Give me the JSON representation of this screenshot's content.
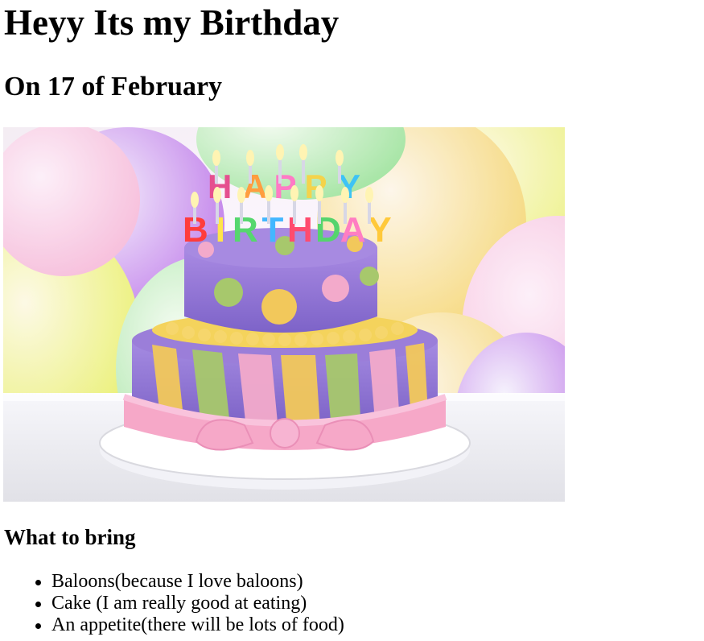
{
  "page": {
    "title": "Heyy Its my Birthday",
    "subtitle": "On 17 of February"
  },
  "hero_image": {
    "caption": "",
    "banner_text_top": "HAPPY",
    "banner_text_bottom": "BIRTHDAY",
    "icon": "birthday-cake-image"
  },
  "section": {
    "heading": "What to bring",
    "items": [
      "Baloons(because I love baloons)",
      "Cake (I am really good at eating)",
      "An appetite(there will be lots of food)"
    ]
  },
  "colors": {
    "text": "#000000",
    "background": "#ffffff",
    "cake_purple": "#9a7bd6",
    "cake_pink": "#f3aacb",
    "cake_yellow": "#f2c85b",
    "cake_green": "#a7c86c"
  }
}
